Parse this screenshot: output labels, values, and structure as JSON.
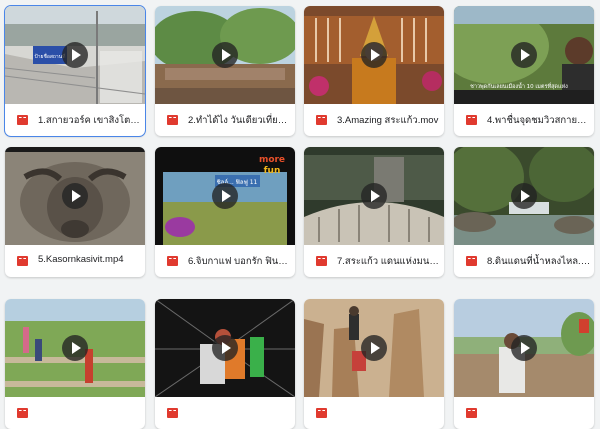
{
  "files": [
    {
      "name": "1.สกายวอร์ค เขาสิงโต สร...",
      "type_icon": "film-icon",
      "selected": true
    },
    {
      "name": "2.ทำได้ไง วันเดียวเที่ยวสร...",
      "type_icon": "film-icon"
    },
    {
      "name": "3.Amazing สระแก้ว.mov",
      "type_icon": "film-icon"
    },
    {
      "name": "4.พาชื่นจุดชมวิวสกายวอล...",
      "type_icon": "film-icon"
    },
    {
      "name": "5.Kasornkasivit.mp4",
      "type_icon": "film-icon"
    },
    {
      "name": "6.จิบกาแฟ บอกรัก ฟินกลา...",
      "type_icon": "film-icon"
    },
    {
      "name": "7.สระแก้ว แดนแห่งมนต์ขลั...",
      "type_icon": "film-icon"
    },
    {
      "name": "8.ดินแดนที่น้ำหลงไหล.mp4",
      "type_icon": "film-icon"
    },
    {
      "name": "",
      "type_icon": "film-icon"
    },
    {
      "name": "",
      "type_icon": "film-icon"
    },
    {
      "name": "",
      "type_icon": "film-icon"
    },
    {
      "name": "",
      "type_icon": "film-icon"
    }
  ],
  "thumb_text": {
    "thumb1_sign": "ป้ายชื่อสถานที่",
    "thumb4_caption": "ชาวพุดกันเลยนเมืองน้ำ 10 เมตรที่สุดแห่ง",
    "thumb6_logo_top": "more",
    "thumb6_logo_bottom": "fun",
    "thumb6_banner": "ชิลล์... ฟิลฟู 11"
  },
  "colors": {
    "film_icon": "#e03a2f",
    "selected_outline": "#4a86e8",
    "background": "#f1f3f4"
  }
}
